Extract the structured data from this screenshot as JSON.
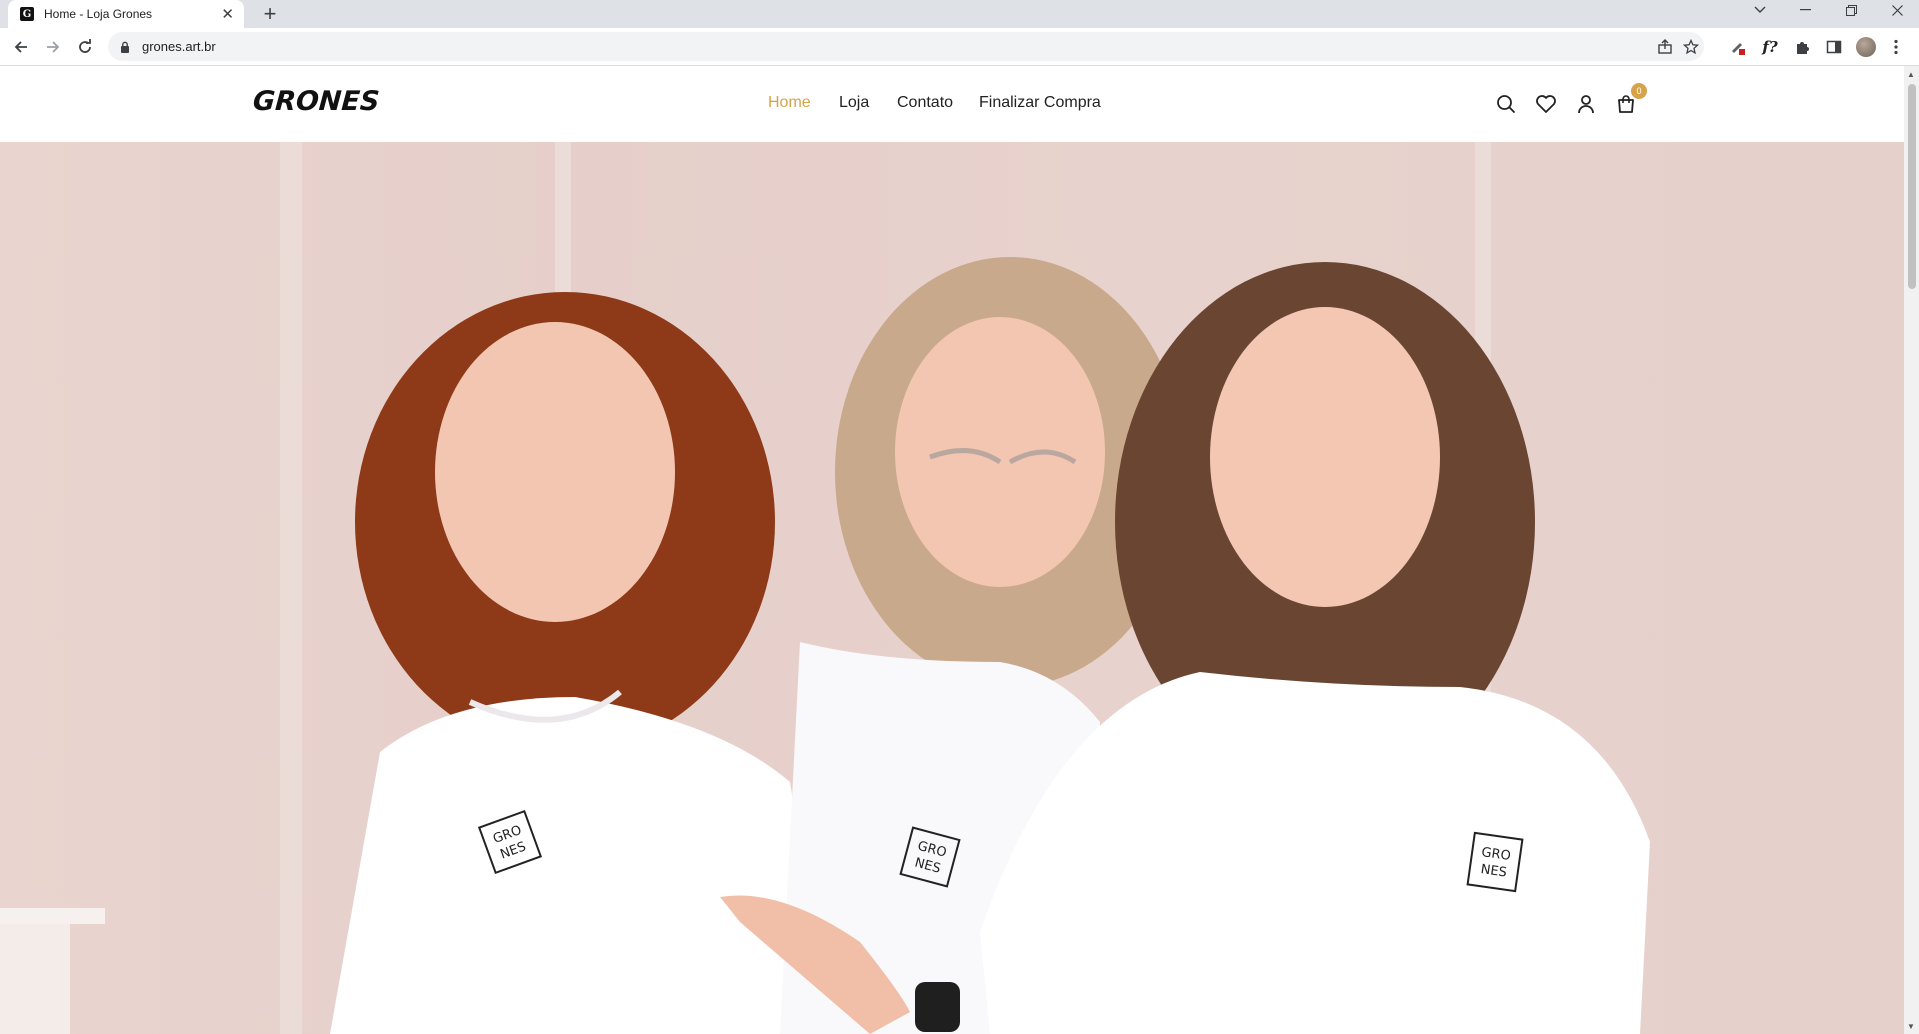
{
  "browser": {
    "tab_title": "Home - Loja Grones",
    "tab_favicon": "G",
    "url": "grones.art.br",
    "extension_f_label": "f?"
  },
  "site": {
    "logo": "GRONES",
    "nav": [
      {
        "label": "Home",
        "active": true
      },
      {
        "label": "Loja",
        "active": false
      },
      {
        "label": "Contato",
        "active": false
      },
      {
        "label": "Finalizar Compra",
        "active": false
      }
    ],
    "cart_count": "0",
    "accent_color": "#d6a34a",
    "hero": {
      "image": "three-women-in-grones-white-tshirts",
      "shirt_logo_lines": [
        "GRO",
        "NES"
      ]
    }
  }
}
